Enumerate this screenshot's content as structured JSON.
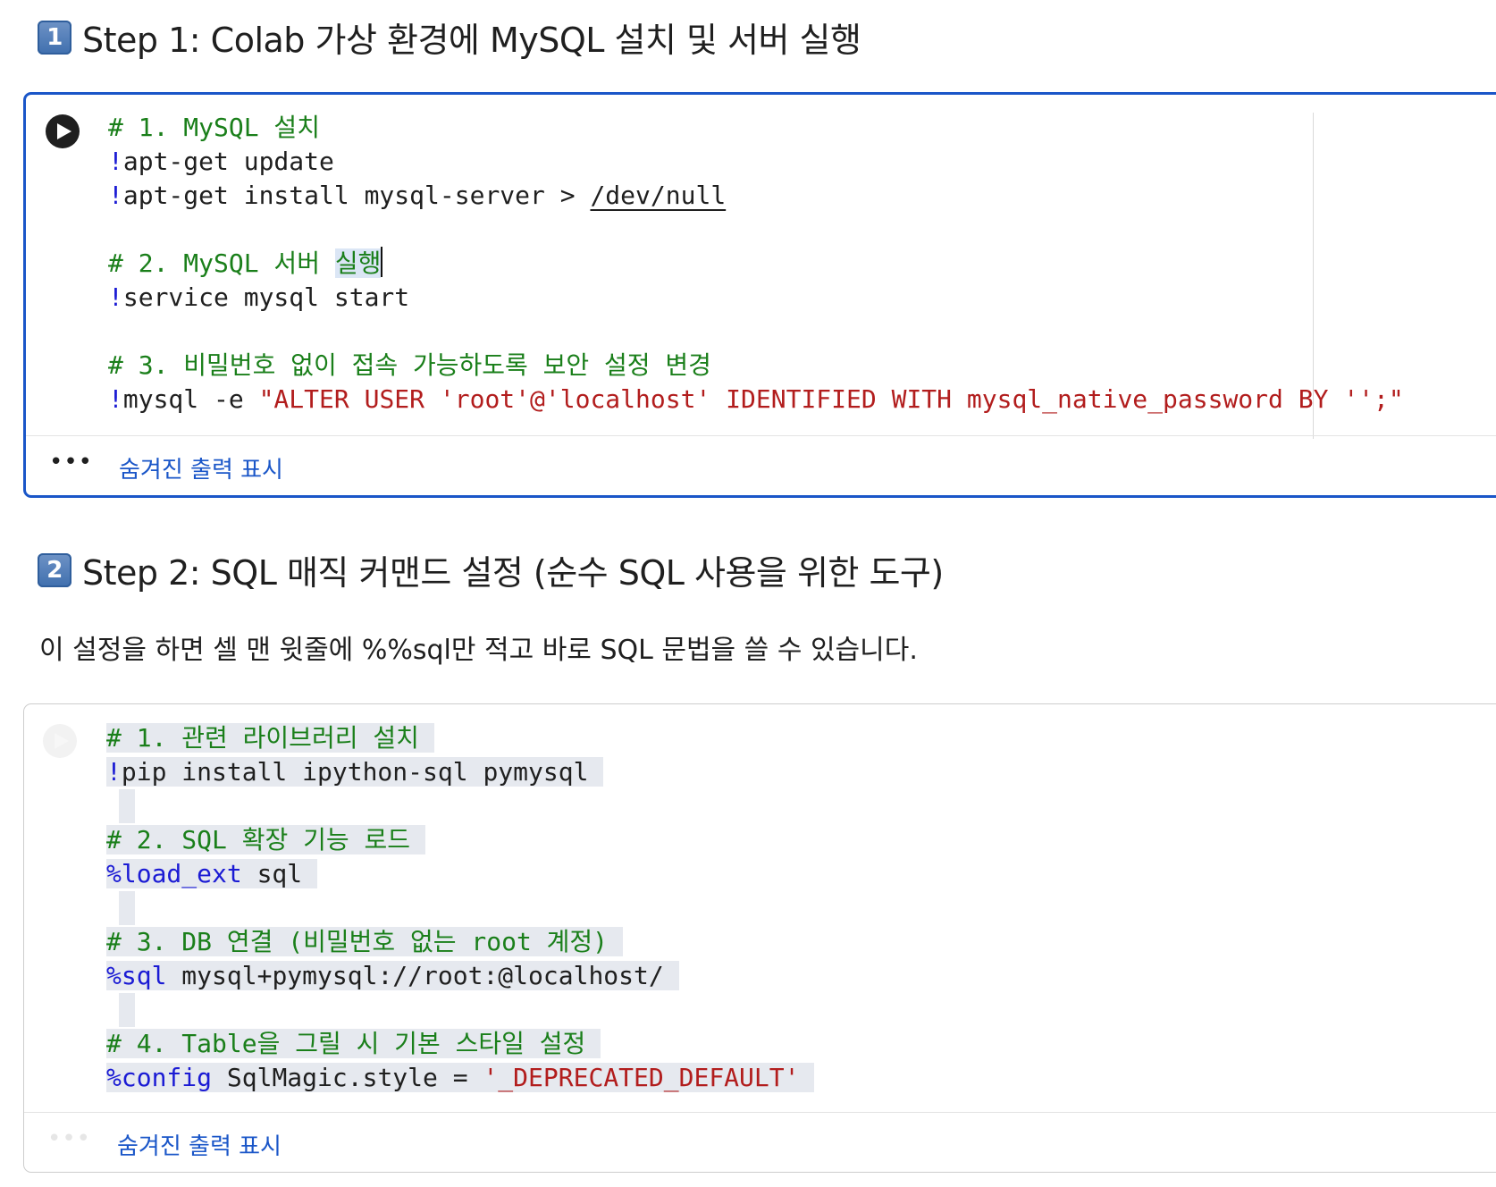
{
  "step1": {
    "keycap": "1",
    "title": "Step 1: Colab 가상 환경에 MySQL 설치 및 서버 실행"
  },
  "cell1": {
    "lines": [
      [
        {
          "t": "# 1. MySQL 설치",
          "c": "com"
        }
      ],
      [
        {
          "t": "!",
          "c": "bang"
        },
        {
          "t": "apt-get update",
          "c": "txt"
        }
      ],
      [
        {
          "t": "!",
          "c": "bang"
        },
        {
          "t": "apt-get install mysql-server > ",
          "c": "txt"
        },
        {
          "t": "/dev/null",
          "c": "txt",
          "u": true
        }
      ],
      [],
      [
        {
          "t": "# 2. MySQL 서버 ",
          "c": "com"
        },
        {
          "t": "실행",
          "c": "com",
          "sel": true
        },
        {
          "caret": true
        }
      ],
      [
        {
          "t": "!",
          "c": "bang"
        },
        {
          "t": "service mysql start",
          "c": "txt"
        }
      ],
      [],
      [
        {
          "t": "# 3. 비밀번호 없이 접속 가능하도록 보안 설정 변경",
          "c": "com"
        }
      ],
      [
        {
          "t": "!",
          "c": "bang"
        },
        {
          "t": "mysql -e ",
          "c": "txt"
        },
        {
          "t": "\"ALTER USER 'root'@'localhost' IDENTIFIED WITH mysql_native_password BY '';\"",
          "c": "str"
        }
      ]
    ],
    "output_label": "숨겨진 출력 표시",
    "more": "•••"
  },
  "step2": {
    "keycap": "2",
    "title": "Step 2: SQL 매직 커맨드 설정 (순수 SQL 사용을 위한 도구)"
  },
  "step2_desc": "이 설정을 하면 셀 맨 윗줄에 %%sql만 적고 바로 SQL 문법을 쓸 수 있습니다.",
  "cell2": {
    "lines": [
      [
        {
          "t": "# 1. 관련 라이브러리 설치 ",
          "c": "com"
        }
      ],
      [
        {
          "t": "!",
          "c": "bang"
        },
        {
          "t": "pip install ipython-sql pymysql ",
          "c": "txt"
        }
      ],
      [
        {
          "t": "",
          "c": "txt"
        }
      ],
      [
        {
          "t": "# 2. SQL 확장 기능 로드 ",
          "c": "com"
        }
      ],
      [
        {
          "t": "%load_ext",
          "c": "mag"
        },
        {
          "t": " sql ",
          "c": "txt"
        }
      ],
      [
        {
          "t": "",
          "c": "txt"
        }
      ],
      [
        {
          "t": "# 3. DB 연결 (비밀번호 없는 root 계정) ",
          "c": "com"
        }
      ],
      [
        {
          "t": "%sql",
          "c": "mag"
        },
        {
          "t": " mysql+pymysql://root:@localhost/ ",
          "c": "txt"
        }
      ],
      [
        {
          "t": "",
          "c": "txt"
        }
      ],
      [
        {
          "t": "# 4. Table을 그릴 시 기본 스타일 설정 ",
          "c": "com"
        }
      ],
      [
        {
          "t": "%config",
          "c": "mag"
        },
        {
          "t": " SqlMagic.style = ",
          "c": "txt"
        },
        {
          "t": "'_DEPRECATED_DEFAULT' ",
          "c": "str"
        }
      ]
    ],
    "output_label": "숨겨진 출력 표시",
    "more": "•••"
  }
}
